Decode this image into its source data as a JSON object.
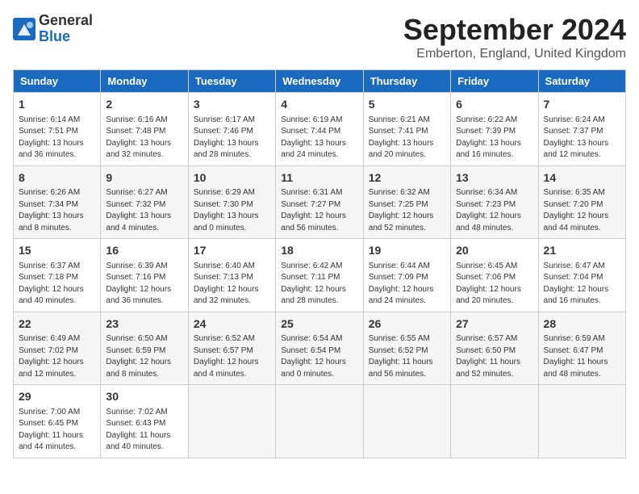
{
  "header": {
    "logo_line1": "General",
    "logo_line2": "Blue",
    "title": "September 2024",
    "subtitle": "Emberton, England, United Kingdom"
  },
  "weekdays": [
    "Sunday",
    "Monday",
    "Tuesday",
    "Wednesday",
    "Thursday",
    "Friday",
    "Saturday"
  ],
  "weeks": [
    [
      {
        "day": "1",
        "info": "Sunrise: 6:14 AM\nSunset: 7:51 PM\nDaylight: 13 hours\nand 36 minutes."
      },
      {
        "day": "2",
        "info": "Sunrise: 6:16 AM\nSunset: 7:48 PM\nDaylight: 13 hours\nand 32 minutes."
      },
      {
        "day": "3",
        "info": "Sunrise: 6:17 AM\nSunset: 7:46 PM\nDaylight: 13 hours\nand 28 minutes."
      },
      {
        "day": "4",
        "info": "Sunrise: 6:19 AM\nSunset: 7:44 PM\nDaylight: 13 hours\nand 24 minutes."
      },
      {
        "day": "5",
        "info": "Sunrise: 6:21 AM\nSunset: 7:41 PM\nDaylight: 13 hours\nand 20 minutes."
      },
      {
        "day": "6",
        "info": "Sunrise: 6:22 AM\nSunset: 7:39 PM\nDaylight: 13 hours\nand 16 minutes."
      },
      {
        "day": "7",
        "info": "Sunrise: 6:24 AM\nSunset: 7:37 PM\nDaylight: 13 hours\nand 12 minutes."
      }
    ],
    [
      {
        "day": "8",
        "info": "Sunrise: 6:26 AM\nSunset: 7:34 PM\nDaylight: 13 hours\nand 8 minutes."
      },
      {
        "day": "9",
        "info": "Sunrise: 6:27 AM\nSunset: 7:32 PM\nDaylight: 13 hours\nand 4 minutes."
      },
      {
        "day": "10",
        "info": "Sunrise: 6:29 AM\nSunset: 7:30 PM\nDaylight: 13 hours\nand 0 minutes."
      },
      {
        "day": "11",
        "info": "Sunrise: 6:31 AM\nSunset: 7:27 PM\nDaylight: 12 hours\nand 56 minutes."
      },
      {
        "day": "12",
        "info": "Sunrise: 6:32 AM\nSunset: 7:25 PM\nDaylight: 12 hours\nand 52 minutes."
      },
      {
        "day": "13",
        "info": "Sunrise: 6:34 AM\nSunset: 7:23 PM\nDaylight: 12 hours\nand 48 minutes."
      },
      {
        "day": "14",
        "info": "Sunrise: 6:35 AM\nSunset: 7:20 PM\nDaylight: 12 hours\nand 44 minutes."
      }
    ],
    [
      {
        "day": "15",
        "info": "Sunrise: 6:37 AM\nSunset: 7:18 PM\nDaylight: 12 hours\nand 40 minutes."
      },
      {
        "day": "16",
        "info": "Sunrise: 6:39 AM\nSunset: 7:16 PM\nDaylight: 12 hours\nand 36 minutes."
      },
      {
        "day": "17",
        "info": "Sunrise: 6:40 AM\nSunset: 7:13 PM\nDaylight: 12 hours\nand 32 minutes."
      },
      {
        "day": "18",
        "info": "Sunrise: 6:42 AM\nSunset: 7:11 PM\nDaylight: 12 hours\nand 28 minutes."
      },
      {
        "day": "19",
        "info": "Sunrise: 6:44 AM\nSunset: 7:09 PM\nDaylight: 12 hours\nand 24 minutes."
      },
      {
        "day": "20",
        "info": "Sunrise: 6:45 AM\nSunset: 7:06 PM\nDaylight: 12 hours\nand 20 minutes."
      },
      {
        "day": "21",
        "info": "Sunrise: 6:47 AM\nSunset: 7:04 PM\nDaylight: 12 hours\nand 16 minutes."
      }
    ],
    [
      {
        "day": "22",
        "info": "Sunrise: 6:49 AM\nSunset: 7:02 PM\nDaylight: 12 hours\nand 12 minutes."
      },
      {
        "day": "23",
        "info": "Sunrise: 6:50 AM\nSunset: 6:59 PM\nDaylight: 12 hours\nand 8 minutes."
      },
      {
        "day": "24",
        "info": "Sunrise: 6:52 AM\nSunset: 6:57 PM\nDaylight: 12 hours\nand 4 minutes."
      },
      {
        "day": "25",
        "info": "Sunrise: 6:54 AM\nSunset: 6:54 PM\nDaylight: 12 hours\nand 0 minutes."
      },
      {
        "day": "26",
        "info": "Sunrise: 6:55 AM\nSunset: 6:52 PM\nDaylight: 11 hours\nand 56 minutes."
      },
      {
        "day": "27",
        "info": "Sunrise: 6:57 AM\nSunset: 6:50 PM\nDaylight: 11 hours\nand 52 minutes."
      },
      {
        "day": "28",
        "info": "Sunrise: 6:59 AM\nSunset: 6:47 PM\nDaylight: 11 hours\nand 48 minutes."
      }
    ],
    [
      {
        "day": "29",
        "info": "Sunrise: 7:00 AM\nSunset: 6:45 PM\nDaylight: 11 hours\nand 44 minutes."
      },
      {
        "day": "30",
        "info": "Sunrise: 7:02 AM\nSunset: 6:43 PM\nDaylight: 11 hours\nand 40 minutes."
      },
      {
        "day": "",
        "info": ""
      },
      {
        "day": "",
        "info": ""
      },
      {
        "day": "",
        "info": ""
      },
      {
        "day": "",
        "info": ""
      },
      {
        "day": "",
        "info": ""
      }
    ]
  ]
}
